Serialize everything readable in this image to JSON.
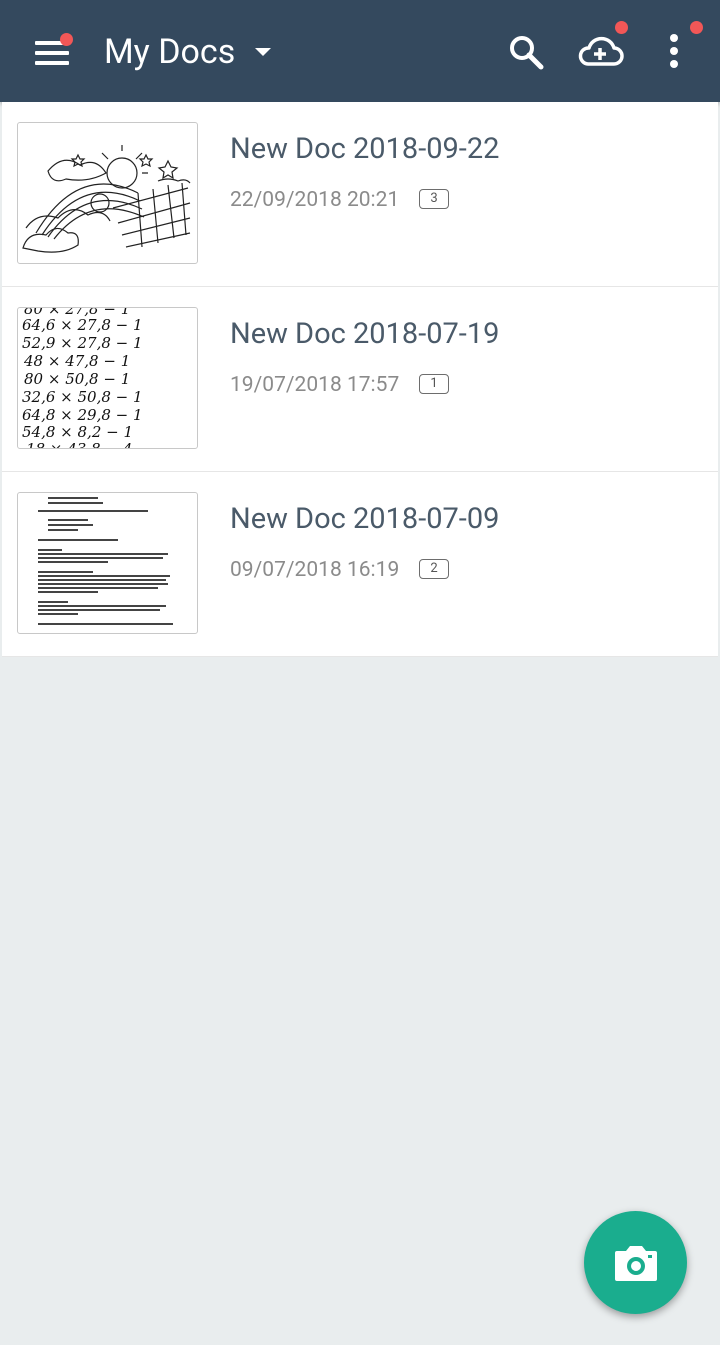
{
  "appbar": {
    "title": "My Docs",
    "menu_icon": "hamburger-menu-icon",
    "search_icon": "search-icon",
    "cloud_icon": "cloud-add-icon",
    "more_icon": "more-vert-icon",
    "bar_color": "#34495e",
    "notification_dot_color": "#f25757"
  },
  "documents": [
    {
      "title": "New Doc 2018-09-22",
      "date": "22/09/2018 20:21",
      "pages": "3",
      "thumbnail": "sketch-drawing-thumbnail"
    },
    {
      "title": "New Doc 2018-07-19",
      "date": "19/07/2018 17:57",
      "pages": "1",
      "thumbnail": "handwritten-math-thumbnail"
    },
    {
      "title": "New Doc 2018-07-09",
      "date": "09/07/2018 16:19",
      "pages": "2",
      "thumbnail": "printed-letter-thumbnail"
    }
  ],
  "fab": {
    "icon": "camera-icon",
    "color": "#1aad8e"
  }
}
